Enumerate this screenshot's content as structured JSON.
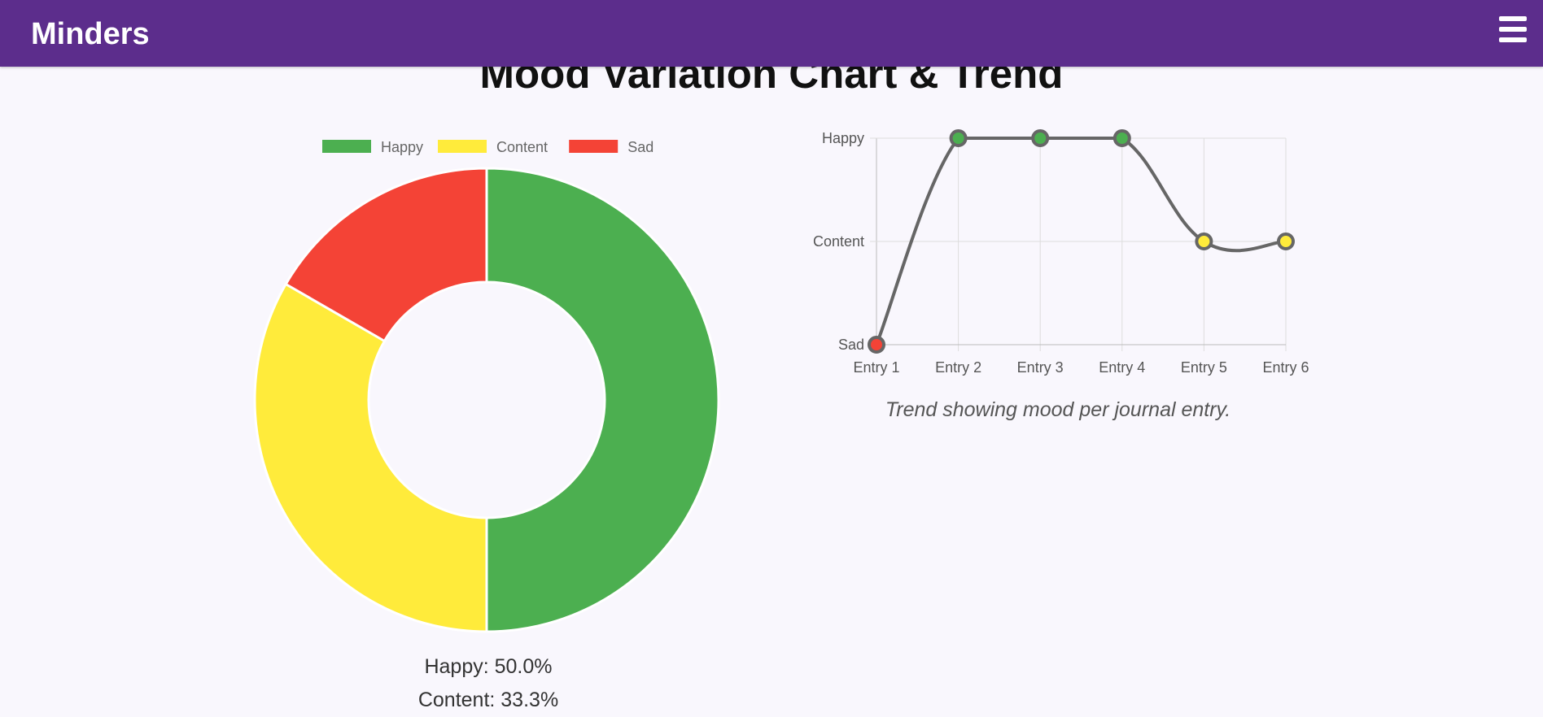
{
  "app": {
    "brand": "Minders"
  },
  "page": {
    "title": "Mood Variation Chart & Trend"
  },
  "nav": {
    "menu_icon": "hamburger-menu-icon"
  },
  "chart_data": [
    {
      "type": "pie",
      "variant": "doughnut",
      "categories": [
        "Happy",
        "Content",
        "Sad"
      ],
      "values": [
        3,
        2,
        1
      ],
      "colors": [
        "#4caf50",
        "#ffeb3b",
        "#f44336"
      ],
      "legend": "top"
    },
    {
      "type": "line",
      "x": [
        "Entry 1",
        "Entry 2",
        "Entry 3",
        "Entry 4",
        "Entry 5",
        "Entry 6"
      ],
      "y": [
        "Sad",
        "Happy",
        "Happy",
        "Happy",
        "Content",
        "Content"
      ],
      "y_categories": [
        "Sad",
        "Content",
        "Happy"
      ],
      "line_color": "#666666",
      "point_colors": {
        "Sad": "#f44336",
        "Content": "#ffeb3b",
        "Happy": "#4caf50"
      },
      "grid": true,
      "caption": "Trend showing mood per journal entry."
    }
  ],
  "stats": [
    "Happy: 50.0%",
    "Content: 33.3%"
  ]
}
